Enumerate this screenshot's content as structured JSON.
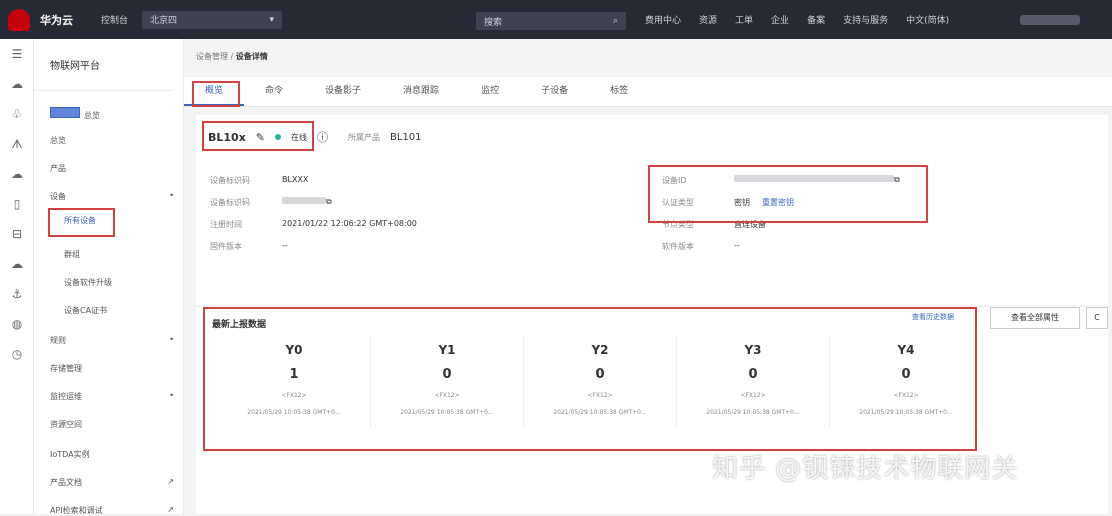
{
  "topbar": {
    "brand": "华为云",
    "console": "控制台",
    "region": "北京四",
    "search_placeholder": "搜索",
    "links": [
      "费用中心",
      "资源",
      "工单",
      "企业",
      "备案",
      "支持与服务",
      "中文(简体)"
    ]
  },
  "sidebar": {
    "title": "物联网平台",
    "items": [
      {
        "label": "总览",
        "badge": true
      },
      {
        "label": "总览"
      },
      {
        "label": "产品"
      },
      {
        "label": "设备",
        "expand": true
      },
      {
        "label": "所有设备",
        "sub": true,
        "selected": true
      },
      {
        "label": "群组",
        "sub": true
      },
      {
        "label": "设备软件升级",
        "sub": true
      },
      {
        "label": "设备CA证书",
        "sub": true
      },
      {
        "label": "规则",
        "expand": true
      },
      {
        "label": "存储管理"
      },
      {
        "label": "监控运维",
        "expand": true
      },
      {
        "label": "资源空间"
      },
      {
        "label": "IoTDA实例"
      },
      {
        "label": "产品文档",
        "ext": true
      },
      {
        "label": "API检索和调试",
        "ext": true
      }
    ]
  },
  "breadcrumb": {
    "parent": "设备管理",
    "current": "设备详情"
  },
  "tabs": [
    "概览",
    "命令",
    "设备影子",
    "消息跟踪",
    "监控",
    "子设备",
    "标签"
  ],
  "device": {
    "name": "BL10x",
    "status": "在线",
    "product_label": "所属产品",
    "product": "BL101",
    "left": [
      {
        "k": "设备标识码",
        "v": "BLXXX"
      },
      {
        "k": "设备标识码",
        "v": ""
      },
      {
        "k": "注册时间",
        "v": "2021/01/22 12:06:22 GMT+08:00"
      },
      {
        "k": "固件版本",
        "v": "--"
      }
    ],
    "right": [
      {
        "k": "设备ID",
        "v": ""
      },
      {
        "k": "认证类型",
        "v": "密钥",
        "link": "重置密钥"
      },
      {
        "k": "节点类型",
        "v": "直连设备"
      },
      {
        "k": "软件版本",
        "v": "--"
      }
    ]
  },
  "latest": {
    "title": "最新上报数据",
    "history": "查看历史数据",
    "all": "查看全部属性",
    "refresh": "C",
    "props": [
      {
        "name": "Y0",
        "value": "1",
        "unit": "<FX12>",
        "time": "2021/05/29 10:05:38 GMT+0..."
      },
      {
        "name": "Y1",
        "value": "0",
        "unit": "<FX12>",
        "time": "2021/05/29 10:05:38 GMT+0..."
      },
      {
        "name": "Y2",
        "value": "0",
        "unit": "<FX12>",
        "time": "2021/05/29 10:05:38 GMT+0..."
      },
      {
        "name": "Y3",
        "value": "0",
        "unit": "<FX12>",
        "time": "2021/05/29 10:05:38 GMT+0..."
      },
      {
        "name": "Y4",
        "value": "0",
        "unit": "<FX12>",
        "time": "2021/05/29 10:05:38 GMT+0..."
      }
    ]
  },
  "watermark": "知乎 @钡铼技术物联网关"
}
